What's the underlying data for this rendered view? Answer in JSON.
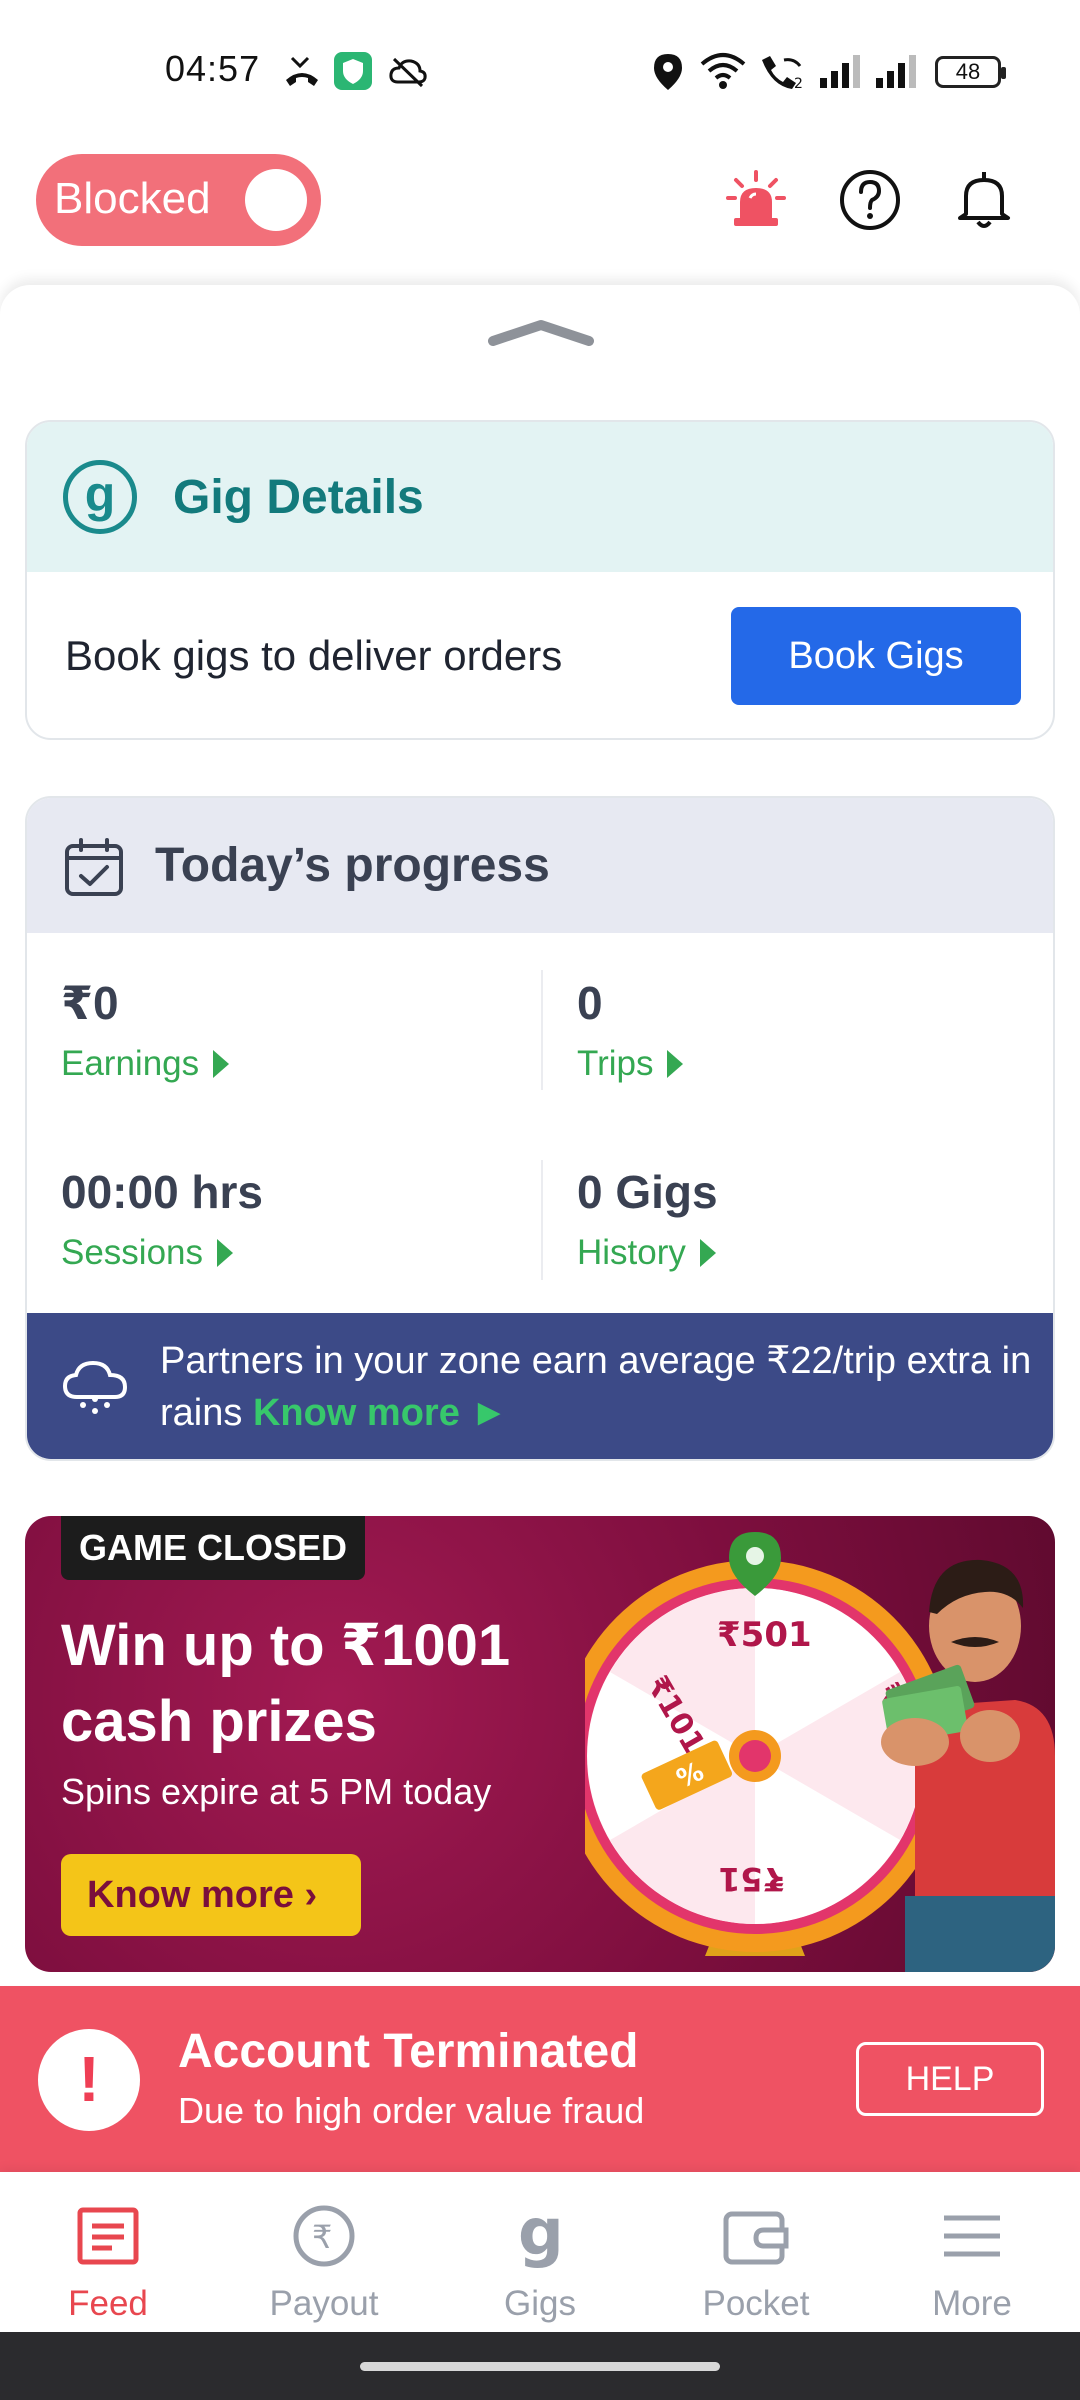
{
  "status_bar": {
    "time": "04:57",
    "battery": "48"
  },
  "header": {
    "status_toggle_label": "Blocked"
  },
  "gig_details": {
    "title": "Gig Details",
    "logo_glyph": "g",
    "description": "Book gigs to deliver orders",
    "button_label": "Book Gigs"
  },
  "progress": {
    "title": "Today’s progress",
    "stats": [
      {
        "value": "₹0",
        "link": "Earnings"
      },
      {
        "value": "0",
        "link": "Trips"
      },
      {
        "value": "00:00 hrs",
        "link": "Sessions"
      },
      {
        "value": "0 Gigs",
        "link": "History"
      }
    ],
    "rain_banner": {
      "text": "Partners in your zone earn average ₹22/trip extra in rains",
      "link": "Know more ►"
    }
  },
  "game_banner": {
    "badge": "GAME CLOSED",
    "title": "Win up to ₹1001 cash prizes",
    "subtitle": "Spins expire at 5 PM today",
    "button_label": "Know more ›",
    "wheel_labels": [
      "₹501",
      "₹101",
      "₹51",
      "₹"
    ]
  },
  "termination": {
    "icon_glyph": "!",
    "title": "Account Terminated",
    "subtitle": "Due to high order value fraud",
    "help_label": "HELP"
  },
  "bottom_nav": [
    {
      "label": "Feed",
      "icon": "feed-icon",
      "active": true
    },
    {
      "label": "Payout",
      "icon": "rupee-icon",
      "active": false
    },
    {
      "label": "Gigs",
      "icon": "gigs-icon",
      "active": false
    },
    {
      "label": "Pocket",
      "icon": "wallet-icon",
      "active": false
    },
    {
      "label": "More",
      "icon": "menu-icon",
      "active": false
    }
  ],
  "colors": {
    "accent_red": "#ef5263",
    "toggle_pink": "#f2707a",
    "teal": "#137a7c",
    "blue_button": "#2469e8",
    "green_link": "#34a852",
    "banner_navy": "#3c4a87",
    "game_magenta": "#7d0e3e",
    "game_yellow": "#f4c518"
  }
}
